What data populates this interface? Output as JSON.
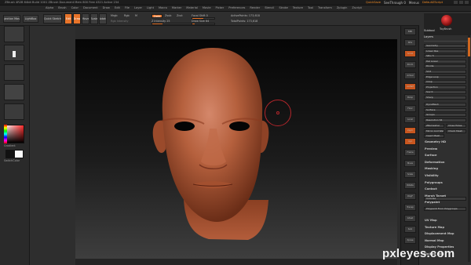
{
  "window": {
    "title": "ZBrush 4R2B 64bit Build 1001 ZBrush Document Mem 800 Free 4321 Active 234",
    "right_items": [
      "QuickSave",
      "SeeThrough 0",
      "Menus",
      "DefaultZScript"
    ]
  },
  "menubar": {
    "items": [
      "Alpha",
      "Brush",
      "Color",
      "Document",
      "Draw",
      "Edit",
      "File",
      "Layer",
      "Light",
      "Macro",
      "Marker",
      "Material",
      "Movie",
      "Picker",
      "Preferences",
      "Render",
      "Stencil",
      "Stroke",
      "Texture",
      "Tool",
      "Transform",
      "Zplugin",
      "Zscript"
    ]
  },
  "topshelf": {
    "projection_master": "Projection Master",
    "lightbox": "LightBox",
    "quick_sketch": "Quick Sketch",
    "edit": "Edit",
    "draw": "Draw",
    "move": "Move",
    "scale": "Scale",
    "rotate": "Rotate",
    "mrgb": "Mrgb",
    "rgb": "Rgb",
    "m": "M",
    "zadd": "Zadd",
    "zsub": "Zsub",
    "zcut": "Zcut",
    "rgb_intensity": "Rgb Intensity",
    "z_intensity": "Z Intensity 25",
    "focal_shift": "Focal Shift 0",
    "draw_size": "Draw Size 64",
    "active_points": "ActivePoints: 173,618",
    "total_points": "TotalPoints: 173,618"
  },
  "leftshelf": {
    "gradient_label": "Gradient",
    "switch_color_label": "SwitchColor"
  },
  "rightpanel": {
    "logo_text": "ToyBrush",
    "header": "Subtool",
    "layers": "Layers",
    "rows": [
      "Geometry",
      "Lower Res",
      "SDiv 5",
      "Del Lower",
      "Divide",
      "Smt",
      "Edge Loop",
      "Crisp",
      "Projection",
      "Suv 0",
      "Sharp"
    ],
    "rows2": [
      "DynaMesh",
      "Surface",
      "Groups",
      "Resolution 64"
    ],
    "buttons": [
      "ZRemesher",
      "Close Holes",
      "Mirror And Weld",
      "Check Mesh",
      "Insert Mesh"
    ],
    "items": [
      "Geometry HD",
      "Preview",
      "Surface",
      "Deformation",
      "Masking",
      "Visibility",
      "Polygroups",
      "Contact",
      "Morph Target",
      "Polypaint",
      "UV Map",
      "Texture Map",
      "Displacement Map",
      "Normal Map",
      "Display Properties",
      "Unified Skin"
    ],
    "polypaint_value": "Colorize",
    "polypaint_btn": "Polypaint From Polygroups"
  },
  "rightstrip": {
    "buttons": [
      "BPR",
      "SPix",
      "Scroll",
      "Zoom",
      "Actual",
      "AAHalf",
      "Persp",
      "Floor",
      "Local",
      "LSym",
      "Xyz",
      "Frame",
      "Move",
      "Scale",
      "Rotate",
      "PolyF",
      "Transp",
      "Ghost",
      "Solo",
      "Xpose"
    ]
  },
  "watermark": "pxleyes.com",
  "colors": {
    "accent": "#e8742a",
    "skin": "#b5603d",
    "cursor": "#b3262b",
    "background": "#2b2b2b"
  }
}
